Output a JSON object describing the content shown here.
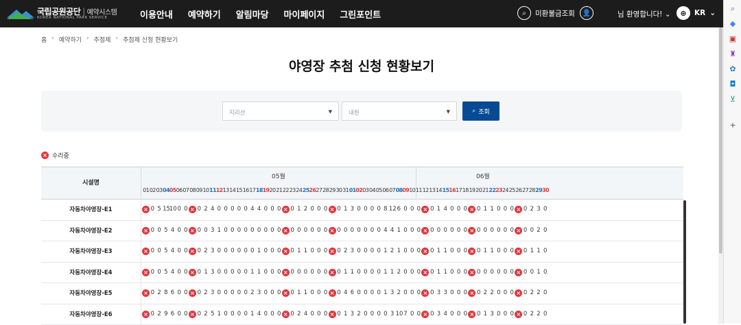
{
  "header": {
    "logo_name": "국립공원공단",
    "logo_system": "예약시스템",
    "logo_sub": "KOREA NATIONAL PARK SERVICE",
    "nav": [
      "이용안내",
      "예약하기",
      "알림마당",
      "마이페이지",
      "그린포인트"
    ],
    "unpaid_label": "미환불금조회",
    "welcome": "님 환영합니다!",
    "lang": "KR"
  },
  "breadcrumb": [
    "홈",
    "예약하기",
    "추첨제",
    "추첨제 신청 현황보기"
  ],
  "page_title": "야영장 추첨 신청 현황보기",
  "filter": {
    "region_value": "지리산",
    "area_value": "내원",
    "search_label": "조회"
  },
  "legend_label": "수리중",
  "table": {
    "facility_header": "시설명",
    "months": [
      "05월",
      "06월"
    ],
    "may_days": [
      "01",
      "02",
      "03",
      "04",
      "05",
      "06",
      "07",
      "08",
      "09",
      "10",
      "11",
      "12",
      "13",
      "14",
      "15",
      "16",
      "17",
      "18",
      "19",
      "20",
      "21",
      "22",
      "23",
      "24",
      "25",
      "26",
      "27",
      "28",
      "29",
      "30",
      "31"
    ],
    "may_types": [
      "",
      "",
      "",
      "sat",
      "sun",
      "",
      "",
      "",
      "",
      "",
      "sat",
      "sun",
      "",
      "",
      "",
      "",
      "",
      "sat",
      "sun",
      "",
      "",
      "",
      "",
      "",
      "sat",
      "sun",
      "",
      "",
      "",
      "",
      ""
    ],
    "jun_days": [
      "01",
      "02",
      "03",
      "04",
      "05",
      "06",
      "07",
      "08",
      "09",
      "10",
      "11",
      "12",
      "13",
      "14",
      "15",
      "16",
      "17",
      "18",
      "19",
      "20",
      "21",
      "22",
      "23",
      "24",
      "25",
      "26",
      "27",
      "28",
      "29",
      "30"
    ],
    "jun_types": [
      "sat",
      "sun",
      "",
      "",
      "",
      "",
      "",
      "sat",
      "sun",
      "",
      "",
      "",
      "",
      "",
      "sat",
      "sun",
      "",
      "",
      "",
      "",
      "",
      "sat",
      "sun",
      "",
      "",
      "",
      "",
      "",
      "sat",
      "sun"
    ],
    "rows": [
      {
        "name": "자동차야영장-E1",
        "cells": [
          "x",
          "0",
          "5",
          "15",
          "10",
          "0",
          "0",
          "x",
          "0",
          "2",
          "4",
          "0",
          "0",
          "0",
          "0",
          "0",
          "4",
          "4",
          "0",
          "0",
          "0",
          "x",
          "0",
          "1",
          "2",
          "0",
          "0",
          "0",
          "x",
          "0",
          "1",
          "3",
          "0",
          "0",
          "0",
          "0",
          "8",
          "12",
          "6",
          "0",
          "0",
          "0",
          "x",
          "0",
          "1",
          "4",
          "0",
          "0",
          "0",
          "x",
          "0",
          "1",
          "1",
          "0",
          "0",
          "0",
          "x",
          "0",
          "2",
          "3",
          "0"
        ]
      },
      {
        "name": "자동차야영장-E2",
        "cells": [
          "x",
          "0",
          "0",
          "5",
          "4",
          "0",
          "0",
          "x",
          "0",
          "0",
          "3",
          "1",
          "0",
          "0",
          "0",
          "0",
          "0",
          "0",
          "0",
          "0",
          "0",
          "x",
          "0",
          "0",
          "0",
          "0",
          "0",
          "0",
          "x",
          "0",
          "0",
          "0",
          "0",
          "0",
          "0",
          "0",
          "4",
          "4",
          "1",
          "0",
          "0",
          "0",
          "x",
          "0",
          "0",
          "0",
          "0",
          "0",
          "0",
          "x",
          "0",
          "0",
          "0",
          "0",
          "0",
          "0",
          "x",
          "0",
          "0",
          "2",
          "0"
        ]
      },
      {
        "name": "자동차야영장-E3",
        "cells": [
          "x",
          "0",
          "0",
          "5",
          "4",
          "0",
          "0",
          "x",
          "0",
          "2",
          "3",
          "0",
          "0",
          "0",
          "0",
          "0",
          "0",
          "1",
          "0",
          "0",
          "0",
          "x",
          "0",
          "1",
          "1",
          "0",
          "0",
          "0",
          "x",
          "0",
          "2",
          "3",
          "0",
          "0",
          "0",
          "0",
          "1",
          "2",
          "1",
          "0",
          "0",
          "0",
          "x",
          "0",
          "1",
          "1",
          "0",
          "0",
          "0",
          "x",
          "0",
          "1",
          "1",
          "0",
          "0",
          "0",
          "x",
          "0",
          "1",
          "1",
          "0"
        ]
      },
      {
        "name": "자동차야영장-E4",
        "cells": [
          "x",
          "0",
          "0",
          "5",
          "4",
          "0",
          "0",
          "x",
          "0",
          "1",
          "3",
          "0",
          "0",
          "0",
          "0",
          "0",
          "1",
          "1",
          "0",
          "0",
          "0",
          "x",
          "0",
          "0",
          "0",
          "0",
          "0",
          "0",
          "x",
          "0",
          "1",
          "1",
          "0",
          "0",
          "0",
          "0",
          "1",
          "1",
          "2",
          "0",
          "0",
          "0",
          "x",
          "0",
          "1",
          "1",
          "0",
          "0",
          "0",
          "x",
          "0",
          "0",
          "0",
          "0",
          "0",
          "0",
          "x",
          "0",
          "0",
          "1",
          "0"
        ]
      },
      {
        "name": "자동차야영장-E5",
        "cells": [
          "x",
          "0",
          "2",
          "8",
          "6",
          "0",
          "0",
          "x",
          "0",
          "2",
          "3",
          "0",
          "0",
          "0",
          "0",
          "0",
          "2",
          "3",
          "0",
          "0",
          "0",
          "x",
          "0",
          "1",
          "1",
          "0",
          "0",
          "0",
          "x",
          "0",
          "4",
          "6",
          "0",
          "0",
          "0",
          "0",
          "1",
          "3",
          "2",
          "0",
          "0",
          "0",
          "x",
          "0",
          "3",
          "3",
          "0",
          "0",
          "0",
          "x",
          "0",
          "2",
          "2",
          "0",
          "0",
          "0",
          "x",
          "0",
          "2",
          "2",
          "0"
        ]
      },
      {
        "name": "자동차야영장-E6",
        "cells": [
          "x",
          "0",
          "2",
          "9",
          "6",
          "0",
          "0",
          "x",
          "0",
          "2",
          "5",
          "1",
          "0",
          "0",
          "0",
          "0",
          "1",
          "4",
          "0",
          "0",
          "0",
          "x",
          "0",
          "2",
          "4",
          "0",
          "0",
          "0",
          "x",
          "0",
          "1",
          "3",
          "2",
          "0",
          "0",
          "0",
          "0",
          "3",
          "10",
          "7",
          "0",
          "0",
          "x",
          "0",
          "3",
          "4",
          "0",
          "0",
          "0",
          "x",
          "0",
          "1",
          "3",
          "0",
          "0",
          "0",
          "x",
          "0",
          "2",
          "2",
          "0"
        ]
      }
    ]
  },
  "colors": {
    "topbar": "#1c1c1c",
    "search_button": "#054a93",
    "repair_red": "#e0383e",
    "saturday_blue": "#1e6fc1",
    "sunday_red": "#e0383e"
  }
}
